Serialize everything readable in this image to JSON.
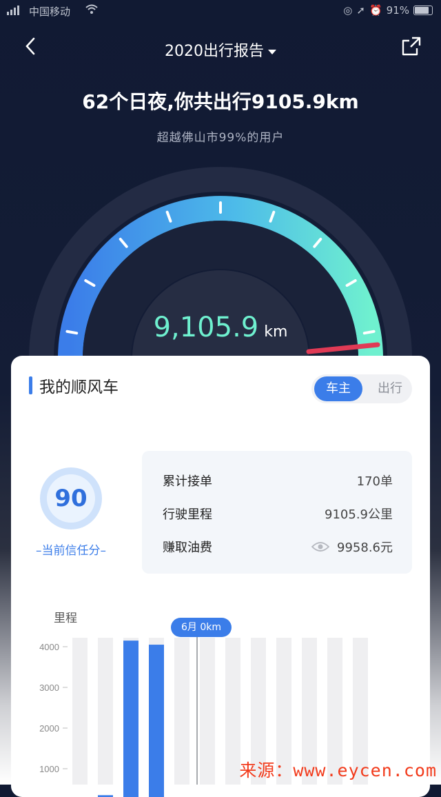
{
  "status": {
    "carrier": "中国移动",
    "battery": "91%"
  },
  "nav": {
    "title": "2020出行报告"
  },
  "summary": {
    "headline": "62个日夜,你共出行9105.9km",
    "subline": "超越佛山市99%的用户"
  },
  "gauge": {
    "value": "9,105.9",
    "unit": "km",
    "accent_start": "#3b7de9",
    "accent_end": "#6ff0cf"
  },
  "card": {
    "title": "我的顺风车",
    "tabs": [
      {
        "label": "车主",
        "active": true
      },
      {
        "label": "出行",
        "active": false
      }
    ],
    "score": {
      "value": "90",
      "label": "–当前信任分–"
    },
    "stats": [
      {
        "label": "累计接单",
        "value": "170单"
      },
      {
        "label": "行驶里程",
        "value": "9105.9公里"
      },
      {
        "label": "赚取油费",
        "value": "9958.6元"
      }
    ]
  },
  "chart_data": {
    "type": "bar",
    "ylabel": "里程",
    "yticks": [
      "4000",
      "3000",
      "2000",
      "1000"
    ],
    "ylim": [
      0,
      4000
    ],
    "values": [
      0,
      350,
      4150,
      4050,
      0,
      0,
      0,
      0,
      0,
      0,
      0,
      0
    ],
    "tooltip": "6月 0km",
    "selected_index": 5,
    "bar_color": "#3b7de9",
    "track_color": "#efeff1"
  },
  "watermark": "来源：www.eycen.com"
}
